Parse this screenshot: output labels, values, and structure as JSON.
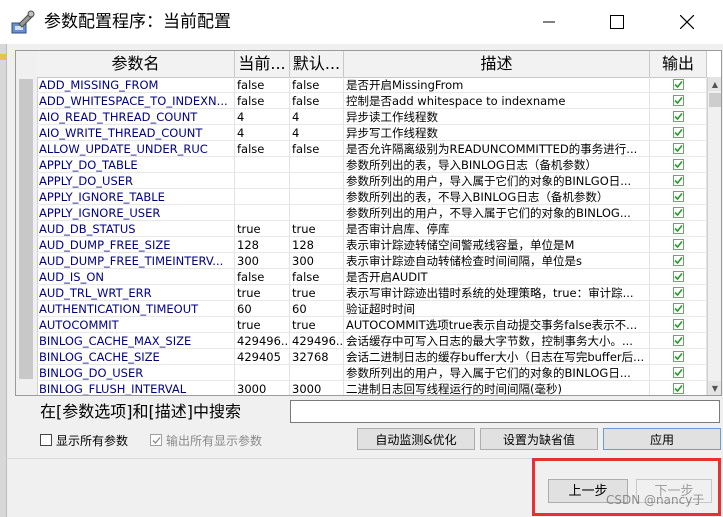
{
  "window": {
    "title": "参数配置程序：当前配置"
  },
  "grid": {
    "columns": {
      "name": "参数名",
      "current": "当前...",
      "default": "默认...",
      "description": "描述",
      "output": "输出"
    },
    "rows": [
      {
        "name": "ADD_MISSING_FROM",
        "current": "false",
        "default": "false",
        "desc": "是否开启MissingFrom",
        "output": true
      },
      {
        "name": "ADD_WHITESPACE_TO_INDEXN...",
        "current": "false",
        "default": "false",
        "desc": "控制是否add whitespace to indexname",
        "output": true
      },
      {
        "name": "AIO_READ_THREAD_COUNT",
        "current": "4",
        "default": "4",
        "desc": "异步读工作线程数",
        "output": true
      },
      {
        "name": "AIO_WRITE_THREAD_COUNT",
        "current": "4",
        "default": "4",
        "desc": "异步写工作线程数",
        "output": true
      },
      {
        "name": "ALLOW_UPDATE_UNDER_RUC",
        "current": "false",
        "default": "false",
        "desc": "是否允许隔离级别为READUNCOMMITTED的事务进行...",
        "output": true
      },
      {
        "name": "APPLY_DO_TABLE",
        "current": "",
        "default": "",
        "desc": "参数所列出的表，导入BINLOG日志（备机参数）",
        "output": true
      },
      {
        "name": "APPLY_DO_USER",
        "current": "",
        "default": "",
        "desc": "参数所列出的用户，导入属于它们的对象的BINLGO日...",
        "output": true
      },
      {
        "name": "APPLY_IGNORE_TABLE",
        "current": "",
        "default": "",
        "desc": "参数所列出的表，不导入BINLOG日志（备机参数）",
        "output": true
      },
      {
        "name": "APPLY_IGNORE_USER",
        "current": "",
        "default": "",
        "desc": "参数所列出的用户，不导入属于它们的对象的BINLOG...",
        "output": true
      },
      {
        "name": "AUD_DB_STATUS",
        "current": "true",
        "default": "true",
        "desc": "是否审计启库、停库",
        "output": true
      },
      {
        "name": "AUD_DUMP_FREE_SIZE",
        "current": "128",
        "default": "128",
        "desc": "表示审计踪迹转储空间警戒线容量，单位是M",
        "output": true
      },
      {
        "name": "AUD_DUMP_FREE_TIMEINTERV...",
        "current": "300",
        "default": "300",
        "desc": "表示审计踪迹自动转储检查时间间隔，单位是s",
        "output": true
      },
      {
        "name": "AUD_IS_ON",
        "current": "false",
        "default": "false",
        "desc": "是否开启AUDIT",
        "output": true
      },
      {
        "name": "AUD_TRL_WRT_ERR",
        "current": "true",
        "default": "true",
        "desc": "表示写审计踪迹出错时系统的处理策略，true：审计踪...",
        "output": true
      },
      {
        "name": "AUTHENTICATION_TIMEOUT",
        "current": "60",
        "default": "60",
        "desc": "验证超时时间",
        "output": true
      },
      {
        "name": "AUTOCOMMIT",
        "current": "true",
        "default": "true",
        "desc": "AUTOCOMMIT选项true表示自动提交事务false表示不...",
        "output": true
      },
      {
        "name": "BINLOG_CACHE_MAX_SIZE",
        "current": "429496...",
        "default": "429496...",
        "desc": "会话缓存中可写入日志的最大字节数，控制事务大小。...",
        "output": true
      },
      {
        "name": "BINLOG_CACHE_SIZE",
        "current": "429405",
        "default": "32768",
        "desc": "会话二进制日志的缓存buffer大小（日志在写完buffer后...",
        "output": true
      },
      {
        "name": "BINLOG_DO_USER",
        "current": "",
        "default": "",
        "desc": "参数所列出的用户，导入属于它们的对象的BINLOG日...",
        "output": true
      },
      {
        "name": "BINLOG_FLUSH_INTERVAL",
        "current": "3000",
        "default": "3000",
        "desc": "二进制日志回写线程运行的时间间隔(毫秒)",
        "output": true
      }
    ]
  },
  "search": {
    "label": "在[参数选项]和[描述]中搜索",
    "value": ""
  },
  "options": {
    "show_all": "显示所有参数",
    "output_all": "输出所有显示参数"
  },
  "buttons": {
    "auto": "自动监测&优化",
    "set_default": "设置为缺省值",
    "apply": "应用",
    "prev": "上一步",
    "next": "下一步"
  },
  "watermark": "CSDN @nancy于",
  "colors": {
    "highlight": "#e83030",
    "check": "#2a9a2a",
    "name_text": "#000080"
  }
}
